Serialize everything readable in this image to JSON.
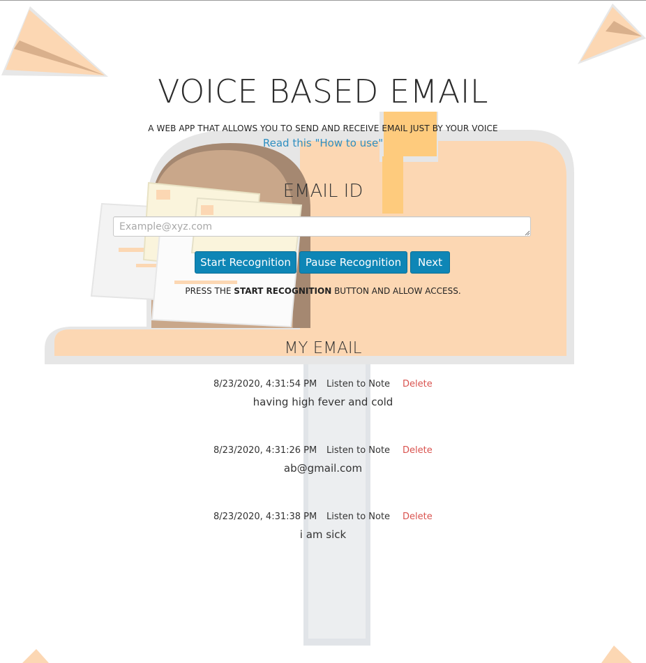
{
  "header": {
    "title": "VOICE BASED EMAIL",
    "subtitle": "A WEB APP THAT ALLOWS YOU TO SEND AND RECEIVE EMAIL JUST BY YOUR VOICE",
    "howto_link": "Read this \"How to use\""
  },
  "email_section": {
    "heading": "EMAIL ID",
    "input_value": "",
    "input_placeholder": "Example@xyz.com",
    "buttons": {
      "start": "Start Recognition",
      "pause": "Pause Recognition",
      "next": "Next"
    },
    "instruction_prefix": "PRESS THE ",
    "instruction_bold": "START RECOGNITION",
    "instruction_suffix": " BUTTON AND ALLOW ACCESS."
  },
  "my_email": {
    "heading": "MY EMAIL",
    "notes": [
      {
        "date": "8/23/2020, 4:31:54 PM",
        "listen": "Listen to Note",
        "delete": "Delete",
        "text": "having high fever and cold"
      },
      {
        "date": "8/23/2020, 4:31:26 PM",
        "listen": "Listen to Note",
        "delete": "Delete",
        "text": "ab@gmail.com"
      },
      {
        "date": "8/23/2020, 4:31:38 PM",
        "listen": "Listen to Note",
        "delete": "Delete",
        "text": "i am sick"
      }
    ]
  },
  "colors": {
    "accent_button": "#0e86b6",
    "link": "#2f8fc1",
    "delete": "#d9534f",
    "mailbox_body": "#fcd7b3",
    "mailbox_flag": "#fecb7d",
    "mailbox_door": "#c9a78a"
  }
}
